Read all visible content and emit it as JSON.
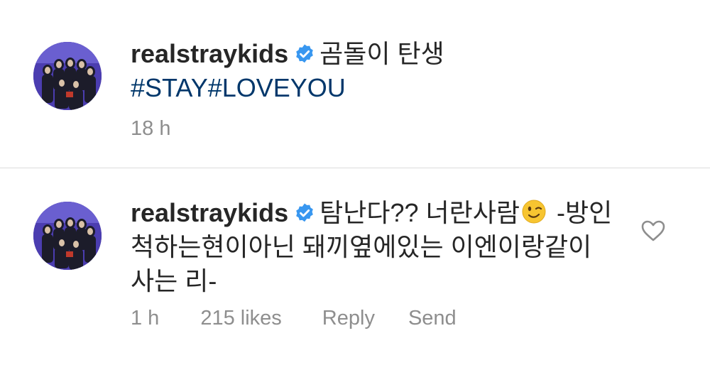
{
  "caption": {
    "username": "realstraykids",
    "text": "곰돌이 탄생",
    "hashtags": "#STAY#LOVEYOU",
    "time": "18 h"
  },
  "comment": {
    "username": "realstraykids",
    "text_before_emoji": "탐난다?? 너란사람",
    "text_after_emoji": " -방인척하는현이아닌 돼끼옆에있는 이엔이랑같이사는 리-",
    "time": "1 h",
    "likes": "215 likes",
    "reply_label": "Reply",
    "send_label": "Send"
  },
  "colors": {
    "verified": "#3897f0",
    "hashtag": "#00376b",
    "meta": "#8e8e8e"
  },
  "icons": {
    "verified": "verified-badge-icon",
    "emoji": "winking-face-emoji",
    "like": "heart-outline-icon"
  }
}
